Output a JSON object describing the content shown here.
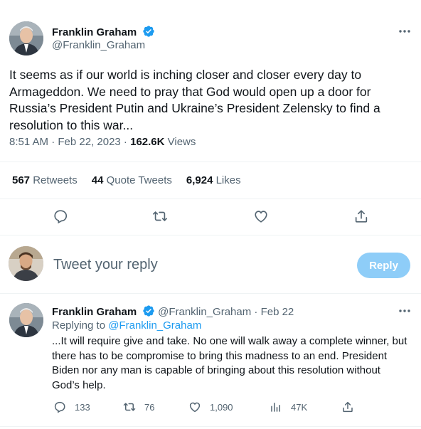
{
  "main_tweet": {
    "author_name": "Franklin Graham",
    "author_handle": "@Franklin_Graham",
    "text": "It seems as if our world is inching closer and closer every day to Armageddon. We need to pray that God would open up a door for Russia’s President Putin and Ukraine’s President Zelensky to find a resolution to this war...",
    "time": "8:51 AM · Feb 22, 2023 · ",
    "views_count": "162.6K",
    "views_label": " Views",
    "retweets_count": "567",
    "retweets_label": " Retweets",
    "quote_tweets_count": "44",
    "quote_tweets_label": " Quote Tweets",
    "likes_count": "6,924",
    "likes_label": " Likes"
  },
  "reply_box": {
    "placeholder": "Tweet your reply",
    "button_label": "Reply"
  },
  "reply_tweet": {
    "author_name": "Franklin Graham",
    "author_handle": "@Franklin_Graham",
    "dot": " · ",
    "date": "Feb 22",
    "replying_prefix": "Replying to ",
    "replying_handle": "@Franklin_Graham",
    "text": "...It will require give and take. No one will walk away a complete winner, but there has to be compromise to bring this madness to an end. President Biden nor any man is capable of bringing about this resolution without God’s help.",
    "replies": "133",
    "retweets": "76",
    "likes": "1,090",
    "views": "47K"
  },
  "colors": {
    "accent": "#1d9bf0",
    "reply_button_disabled": "#8ecdf8",
    "secondary_text": "#536471"
  },
  "icons": [
    "verified-badge-icon",
    "more-icon",
    "reply-icon",
    "retweet-icon",
    "like-icon",
    "share-icon",
    "views-icon"
  ]
}
